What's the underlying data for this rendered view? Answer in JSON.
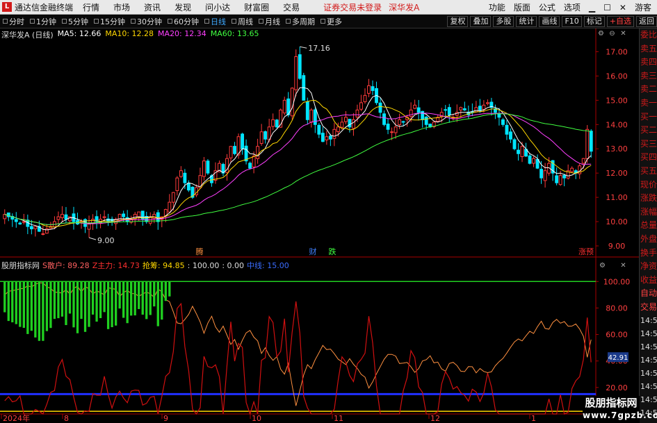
{
  "app": {
    "logo": "L",
    "title": "通达信金融终端",
    "status": "证券交易未登录",
    "stock_name": "深华发A"
  },
  "menu": [
    "行情",
    "市场",
    "资讯",
    "发现",
    "问小达",
    "财富圈",
    "交易"
  ],
  "menu_right": [
    "功能",
    "版面",
    "公式",
    "选项"
  ],
  "guest": "游客",
  "periods": [
    {
      "label": "分时",
      "active": false
    },
    {
      "label": "1分钟",
      "active": false
    },
    {
      "label": "5分钟",
      "active": false
    },
    {
      "label": "15分钟",
      "active": false
    },
    {
      "label": "30分钟",
      "active": false
    },
    {
      "label": "60分钟",
      "active": false
    },
    {
      "label": "日线",
      "active": true
    },
    {
      "label": "周线",
      "active": false
    },
    {
      "label": "月线",
      "active": false
    },
    {
      "label": "多周期",
      "active": false
    },
    {
      "label": "更多",
      "active": false
    }
  ],
  "tools": [
    "复权",
    "叠加",
    "多股",
    "统计",
    "画线",
    "F10",
    "标记",
    "+自选",
    "返回"
  ],
  "legend": {
    "stock": "深华发A (日线)",
    "ma5": "MA5: 12.66",
    "ma10": "MA10: 12.28",
    "ma20": "MA20: 12.34",
    "ma60": "MA60: 13.65",
    "colors": {
      "ma5": "#ffffff",
      "ma10": "#ffd700",
      "ma20": "#ff40ff",
      "ma60": "#40ff40",
      "up": "#ff3b3b",
      "down": "#00e5ff"
    }
  },
  "side_panel": {
    "quote_items": [
      "委比",
      "卖五",
      "卖四",
      "卖三",
      "卖二",
      "卖一",
      "买一",
      "买二",
      "买三",
      "买四",
      "买五",
      "现价",
      "涨跌",
      "涨幅",
      "总量",
      "外盘",
      "换手",
      "净资",
      "收益"
    ],
    "trade_items": [
      "自动",
      "交易"
    ],
    "times": [
      "14:56",
      "14:56",
      "14:56",
      "14:56",
      "14:56",
      "14:56",
      "14:56",
      "14:56",
      "14:56"
    ]
  },
  "indicator": {
    "name": "股朋指标网",
    "s_label": "S散户: 89.28",
    "z_label": "Z主力: 14.73",
    "q_label": "抢筹: 94.85",
    "extra1": ": 100.00",
    "extra2": ": 0.00",
    "mid_label": "中线: 15.00",
    "current_value": "42.91"
  },
  "annotations": [
    {
      "text": "腾",
      "color": "#ff9040"
    },
    {
      "text": "财",
      "color": "#4080ff"
    },
    {
      "text": "跌",
      "color": "#40ff40"
    },
    {
      "text": "涨预",
      "color": "#ff3030"
    }
  ],
  "watermark": {
    "line1": "股朋指标网",
    "line2": "www.7gpzb.com"
  },
  "chart_data": [
    {
      "type": "candlestick",
      "title": "",
      "yticks": [
        9.0,
        10.0,
        11.0,
        12.0,
        13.0,
        14.0,
        15.0,
        16.0,
        17.0
      ],
      "ylim": [
        8.6,
        17.5
      ],
      "x_labels": [
        "2024年",
        "8",
        "9",
        "10",
        "11",
        "12",
        "1"
      ],
      "high_label": "17.16",
      "low_label": "9.00",
      "closes": [
        10.3,
        10.2,
        10.1,
        10.0,
        9.9,
        10.0,
        9.8,
        9.7,
        9.8,
        9.6,
        9.5,
        9.7,
        9.8,
        10.0,
        10.2,
        10.3,
        10.1,
        10.2,
        10.0,
        9.9,
        10.0,
        9.8,
        9.9,
        10.1,
        10.0,
        10.1,
        10.2,
        10.0,
        10.0,
        10.1,
        10.3,
        10.2,
        10.0,
        10.1,
        10.3,
        10.4,
        10.1,
        10.0,
        10.2,
        10.3,
        10.0,
        10.2,
        10.5,
        10.8,
        11.2,
        11.8,
        12.1,
        11.6,
        11.3,
        11.0,
        11.4,
        11.9,
        12.5,
        12.0,
        11.6,
        12.1,
        12.4,
        12.0,
        12.6,
        13.1,
        12.8,
        13.5,
        13.0,
        12.5,
        12.2,
        12.7,
        13.1,
        13.7,
        13.4,
        13.9,
        14.2,
        13.9,
        14.6,
        15.0,
        14.4,
        15.5,
        16.8,
        15.9,
        15.0,
        14.2,
        14.6,
        14.0,
        13.6,
        13.3,
        13.5,
        13.4,
        13.8,
        13.9,
        14.1,
        14.3,
        13.9,
        14.2,
        14.6,
        14.9,
        15.2,
        15.6,
        15.4,
        14.9,
        14.5,
        14.0,
        13.8,
        13.7,
        13.9,
        14.2,
        14.1,
        14.3,
        14.6,
        14.8,
        14.5,
        14.2,
        14.0,
        13.9,
        14.1,
        14.3,
        14.5,
        14.6,
        14.4,
        14.3,
        14.5,
        14.7,
        14.6,
        14.4,
        14.5,
        14.7,
        14.6,
        14.8,
        14.9,
        14.7,
        14.5,
        14.3,
        14.0,
        13.6,
        13.4,
        13.0,
        12.8,
        13.1,
        12.7,
        12.4,
        12.6,
        12.2,
        11.8,
        12.1,
        12.4,
        12.0,
        11.6,
        11.9,
        11.8,
        12.1,
        12.2,
        12.0,
        12.3,
        12.6,
        13.8,
        12.9
      ]
    },
    {
      "type": "line",
      "title": "股朋指标网",
      "yticks": [
        20.0,
        40.0,
        60.0,
        80.0,
        100.0
      ],
      "ylim": [
        0,
        108
      ],
      "series": [
        {
          "name": "S散户",
          "color": "#ff9040"
        },
        {
          "name": "Z主力",
          "color": "#d01010"
        },
        {
          "name": "中线",
          "color": "#2030ff",
          "value": 15.0
        },
        {
          "name": "",
          "color": "#ffd700",
          "value": 2.0
        },
        {
          "name": "",
          "color": "#20d020",
          "value": 100.0
        }
      ]
    }
  ]
}
